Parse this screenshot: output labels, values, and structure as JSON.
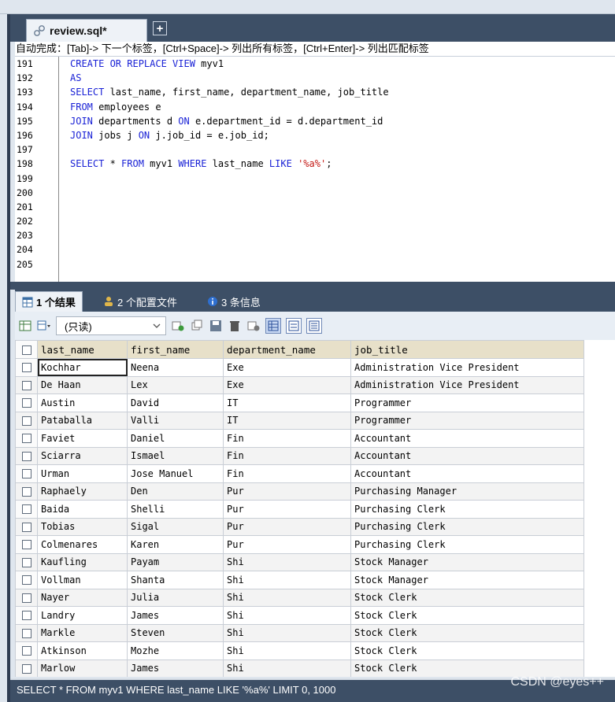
{
  "editor_tab": {
    "title": "review.sql*",
    "new_tab_label": "+"
  },
  "hint_text": "自动完成：[Tab]-> 下一个标签，[Ctrl+Space]-> 列出所有标签，[Ctrl+Enter]-> 列出匹配标签",
  "line_numbers": [
    "191",
    "192",
    "193",
    "194",
    "195",
    "196",
    "197",
    "198",
    "199",
    "200",
    "201",
    "202",
    "203",
    "204",
    "205"
  ],
  "code": {
    "l191a": "CREATE OR REPLACE VIEW",
    "l191b": " myv1",
    "l192a": "AS",
    "l193a": "SELECT",
    "l193b": " last_name, first_name, department_name, job_title",
    "l194a": "FROM",
    "l194b": " employees e",
    "l195a": "JOIN",
    "l195b": " departments d ",
    "l195c": "ON",
    "l195d": " e.department_id = d.department_id",
    "l196a": "JOIN",
    "l196b": " jobs j ",
    "l196c": "ON",
    "l196d": " j.job_id = e.job_id;",
    "l198a": "SELECT",
    "l198b": " * ",
    "l198c": "FROM",
    "l198d": " myv1 ",
    "l198e": "WHERE",
    "l198f": " last_name ",
    "l198g": "LIKE",
    "l198h": " ",
    "l198i": "'%a%'",
    "l198j": ";"
  },
  "result_tabs": [
    {
      "label": "1 个结果"
    },
    {
      "label": "2 个配置文件"
    },
    {
      "label": "3 条信息"
    }
  ],
  "toolbar": {
    "mode_select": "(只读)"
  },
  "table": {
    "columns": [
      "last_name",
      "first_name",
      "department_name",
      "job_title"
    ],
    "rows": [
      [
        "Kochhar",
        "Neena",
        "Exe",
        "Administration Vice President"
      ],
      [
        "De Haan",
        "Lex",
        "Exe",
        "Administration Vice President"
      ],
      [
        "Austin",
        "David",
        "IT",
        "Programmer"
      ],
      [
        "Pataballa",
        "Valli",
        "IT",
        "Programmer"
      ],
      [
        "Faviet",
        "Daniel",
        "Fin",
        "Accountant"
      ],
      [
        "Sciarra",
        "Ismael",
        "Fin",
        "Accountant"
      ],
      [
        "Urman",
        "Jose Manuel",
        "Fin",
        "Accountant"
      ],
      [
        "Raphaely",
        "Den",
        "Pur",
        "Purchasing Manager"
      ],
      [
        "Baida",
        "Shelli",
        "Pur",
        "Purchasing Clerk"
      ],
      [
        "Tobias",
        "Sigal",
        "Pur",
        "Purchasing Clerk"
      ],
      [
        "Colmenares",
        "Karen",
        "Pur",
        "Purchasing Clerk"
      ],
      [
        "Kaufling",
        "Payam",
        "Shi",
        "Stock Manager"
      ],
      [
        "Vollman",
        "Shanta",
        "Shi",
        "Stock Manager"
      ],
      [
        "Nayer",
        "Julia",
        "Shi",
        "Stock Clerk"
      ],
      [
        "Landry",
        "James",
        "Shi",
        "Stock Clerk"
      ],
      [
        "Markle",
        "Steven",
        "Shi",
        "Stock Clerk"
      ],
      [
        "Atkinson",
        "Mozhe",
        "Shi",
        "Stock Clerk"
      ],
      [
        "Marlow",
        "James",
        "Shi",
        "Stock Clerk"
      ]
    ]
  },
  "status_text": "SELECT * FROM myv1 WHERE last_name LIKE '%a%' LIMIT 0, 1000",
  "watermark": "CSDN @eyes++",
  "colors": {
    "frame": "#3d4f66",
    "keyword": "#1a22d6",
    "string": "#c41a16",
    "header": "#e7e0c9"
  }
}
